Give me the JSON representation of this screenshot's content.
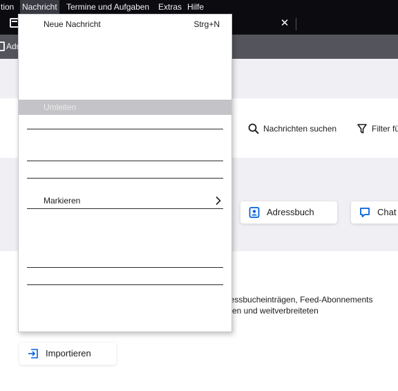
{
  "menubar": {
    "items": [
      {
        "label": "tion"
      },
      {
        "label": "Nachricht",
        "active": true
      },
      {
        "label": "Termine und Aufgaben"
      },
      {
        "label": "Extras"
      },
      {
        "label": "Hilfe"
      }
    ]
  },
  "toolbar": {
    "address_short": "Adr"
  },
  "content": {
    "search_label": "Nachrichten suchen",
    "filter_label": "Filter fü",
    "addressbook_label": "Adressbuch",
    "chat_label": "Chat",
    "desc_line1": "dressbucheinträgen, Feed-Abonnements",
    "desc_line2": "men und weitverbreiteten",
    "import_label": "Importieren"
  },
  "dropdown": {
    "new_message": {
      "label": "Neue Nachricht",
      "shortcut": "Strg+N"
    },
    "redirect": {
      "label": "Umleiten"
    },
    "mark": {
      "label": "Markieren"
    }
  },
  "colors": {
    "menubar_bg": "#0c0c10",
    "toolbar_bg": "#54545c",
    "accent_icon": "#0060df",
    "disabled_bg": "#c4c4c8"
  }
}
